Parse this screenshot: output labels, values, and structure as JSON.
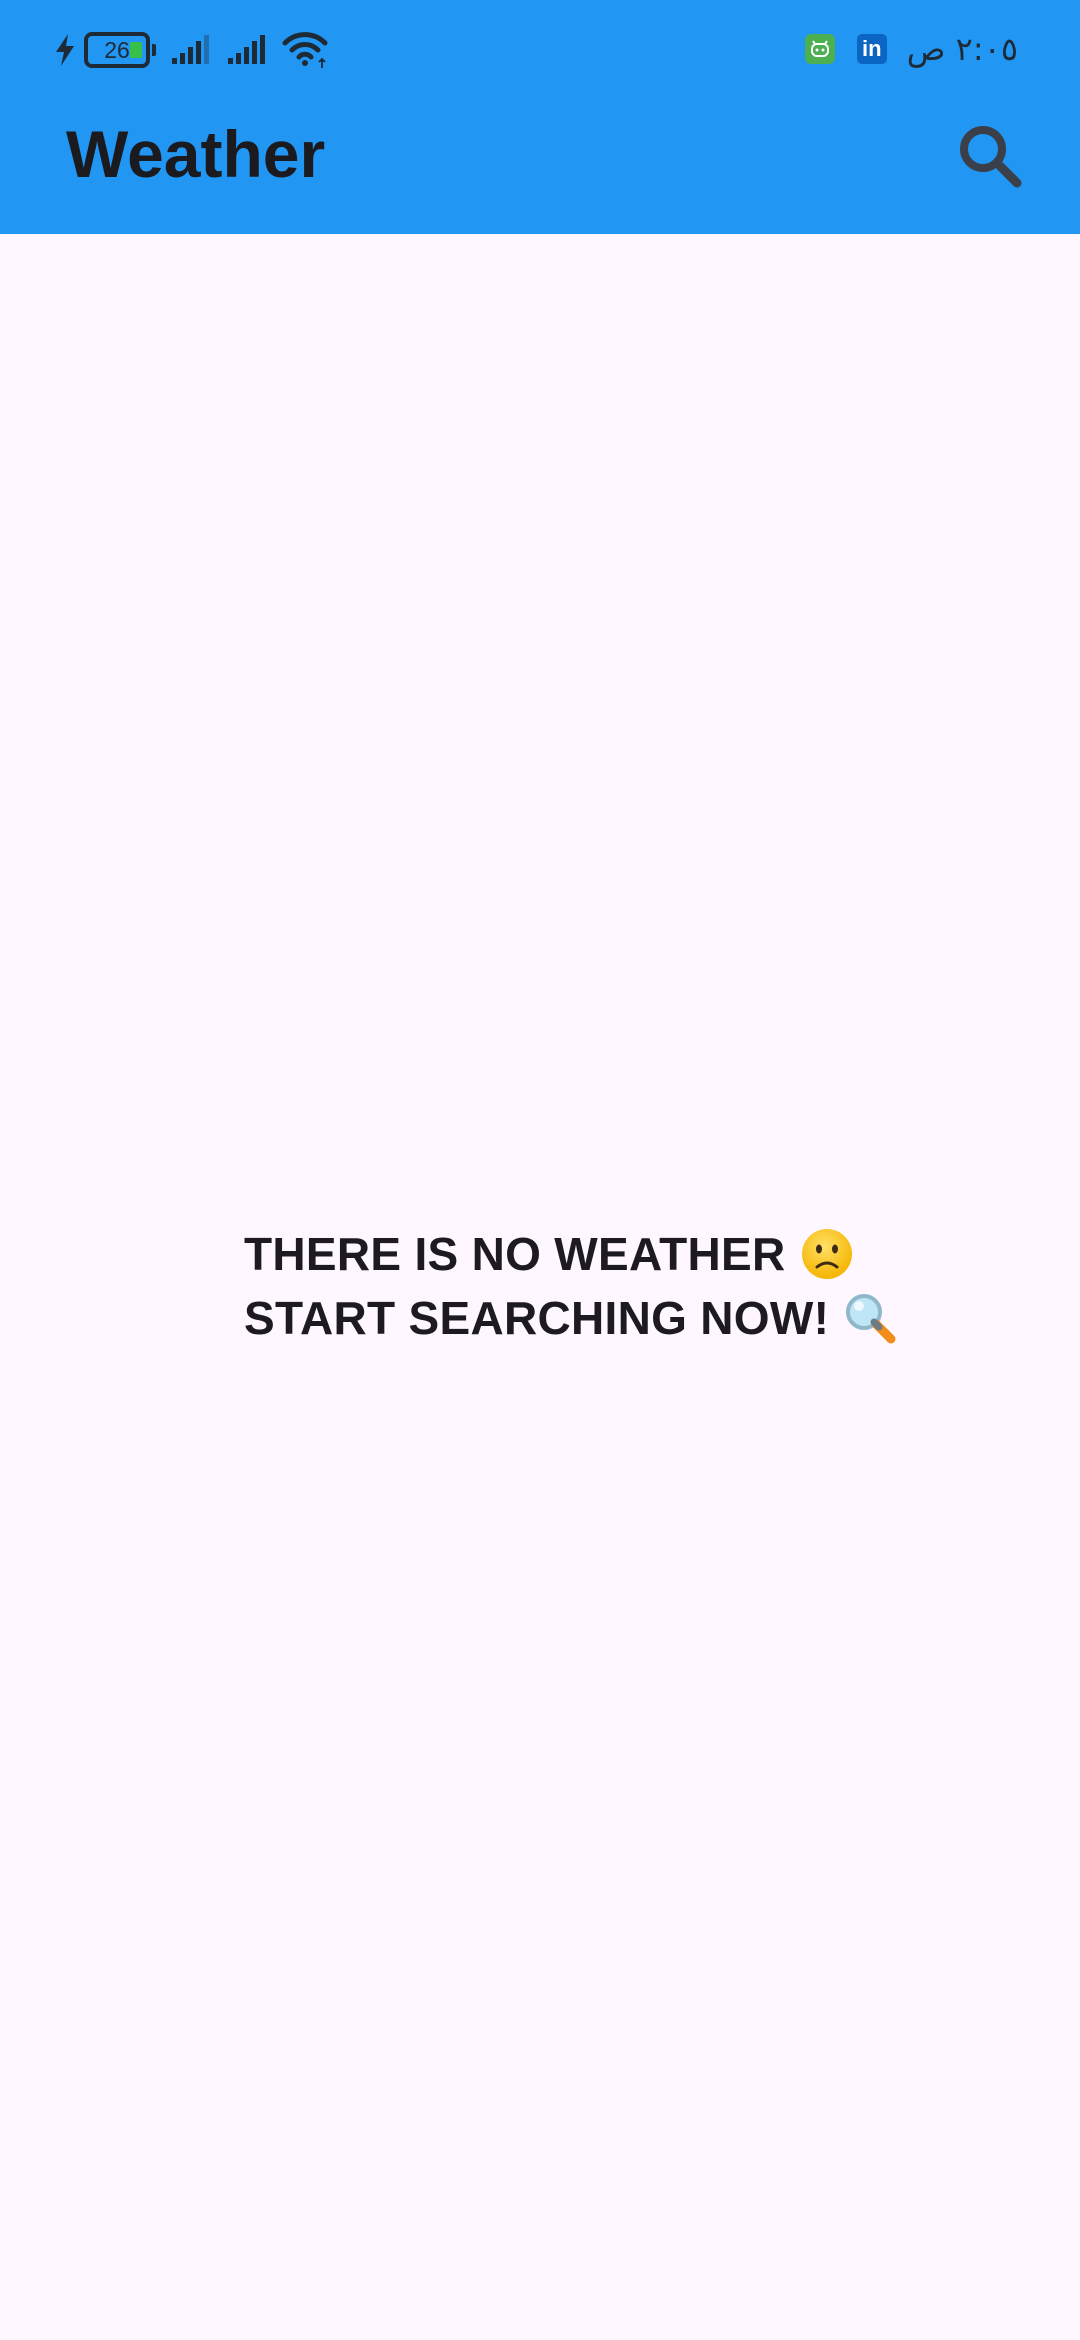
{
  "status_bar": {
    "battery_level": "26",
    "time": "٢:٠٥ ص",
    "icons": [
      "charging-icon",
      "battery-icon",
      "signal-icon",
      "signal-icon",
      "wifi-icon",
      "app-notification-icon",
      "linkedin-icon"
    ],
    "linkedin_label": "in"
  },
  "app_bar": {
    "title": "Weather",
    "search_icon": "search-icon"
  },
  "empty_state": {
    "line1": "THERE IS NO WEATHER",
    "line1_emoji": "slightly-frowning-face-emoji",
    "line2": "START SEARCHING NOW!",
    "line2_emoji": "magnifying-glass-emoji"
  },
  "colors": {
    "app_bar": "#2196F3",
    "background": "#FEF7FF",
    "text": "#1D1B20"
  }
}
